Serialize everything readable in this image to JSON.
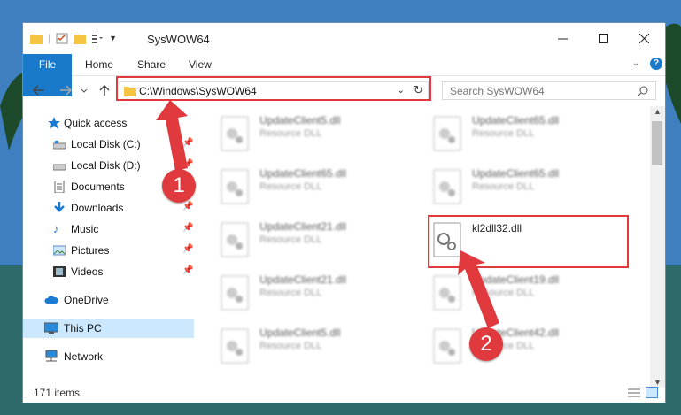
{
  "window": {
    "title": "SysWOW64",
    "status_items": "171 items",
    "accent_color": "#1979ca",
    "highlight_color": "#e0393e"
  },
  "ribbon": {
    "tabs": [
      {
        "label": "File"
      },
      {
        "label": "Home"
      },
      {
        "label": "Share"
      },
      {
        "label": "View"
      }
    ]
  },
  "address": {
    "path": "C:\\Windows\\SysWOW64",
    "search_placeholder": "Search SysWOW64"
  },
  "nav_pane": {
    "items": [
      {
        "label": "Quick access",
        "icon": "star-icon"
      },
      {
        "label": "Local Disk (C:)",
        "icon": "drive-icon",
        "pinned": true
      },
      {
        "label": "Local Disk (D:)",
        "icon": "drive-icon",
        "pinned": true
      },
      {
        "label": "Documents",
        "icon": "documents-icon",
        "pinned": true
      },
      {
        "label": "Downloads",
        "icon": "download-icon",
        "pinned": true
      },
      {
        "label": "Music",
        "icon": "music-icon",
        "pinned": true
      },
      {
        "label": "Pictures",
        "icon": "pictures-icon",
        "pinned": true
      },
      {
        "label": "Videos",
        "icon": "videos-icon",
        "pinned": true
      },
      {
        "label": "OneDrive",
        "icon": "cloud-icon"
      },
      {
        "label": "This PC",
        "icon": "pc-icon",
        "selected": true
      },
      {
        "label": "Network",
        "icon": "network-icon"
      }
    ]
  },
  "files": [
    {
      "name": "UpdateClient5.dll",
      "type": "Resource DLL"
    },
    {
      "name": "UpdateClient65.dll",
      "type": "Resource DLL"
    },
    {
      "name": "UpdateClient65.dll",
      "type": "Resource DLL"
    },
    {
      "name": "UpdateClient65.dll",
      "type": "Resource DLL"
    },
    {
      "name": "UpdateClient21.dll",
      "type": "Resource DLL"
    },
    {
      "name": "kl2dll32.dll",
      "type": ""
    },
    {
      "name": "UpdateClient21.dll",
      "type": "Resource DLL"
    },
    {
      "name": "UpdateClient19.dll",
      "type": "Resource DLL"
    },
    {
      "name": "UpdateClient5.dll",
      "type": "Resource DLL"
    },
    {
      "name": "UpdateClient42.dll",
      "type": "Resource DLL"
    }
  ],
  "annotations": {
    "step1": "1",
    "step2": "2"
  }
}
